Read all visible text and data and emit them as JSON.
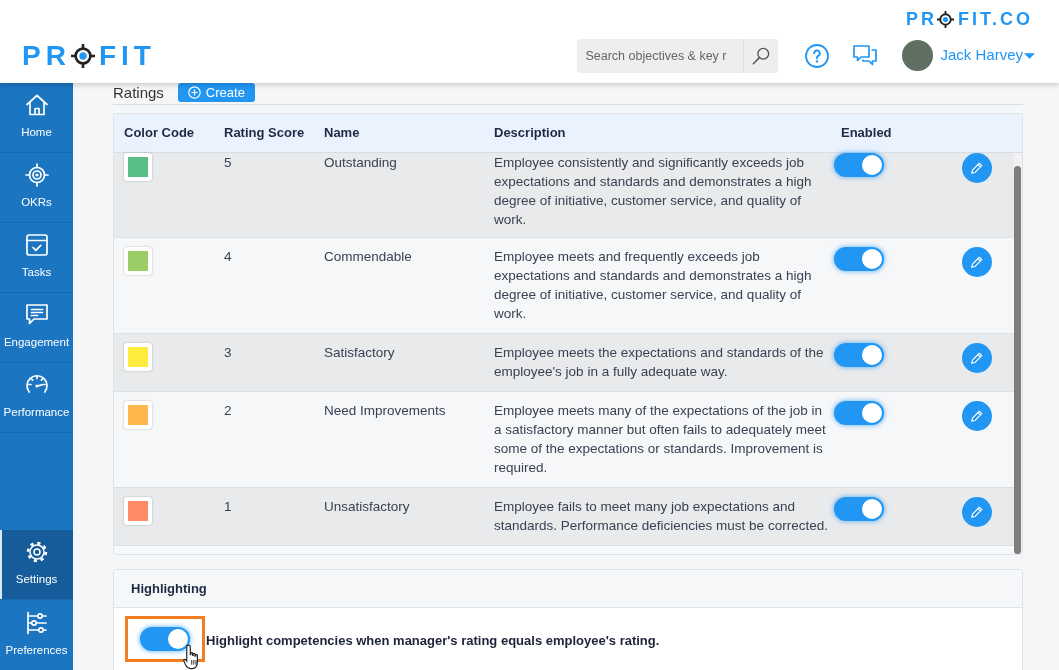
{
  "brand_mark": {
    "text_before": "PR",
    "text_after": "FIT.CO"
  },
  "header": {
    "logo": {
      "text_before": "PR",
      "text_after": "FIT"
    },
    "search": {
      "placeholder": "Search objectives & key r"
    },
    "user": {
      "name": "Jack Harvey"
    }
  },
  "sidebar": {
    "items": [
      {
        "label": "Home",
        "selected": false
      },
      {
        "label": "OKRs",
        "selected": false
      },
      {
        "label": "Tasks",
        "selected": false
      },
      {
        "label": "Engagement",
        "selected": false
      },
      {
        "label": "Performance",
        "selected": false
      }
    ],
    "bottom_items": [
      {
        "label": "Settings",
        "selected": true
      },
      {
        "label": "Preferences",
        "selected": false
      }
    ]
  },
  "page": {
    "title": "Ratings",
    "create_button": "Create"
  },
  "table": {
    "columns": [
      "Color Code",
      "Rating Score",
      "Name",
      "Description",
      "Enabled"
    ],
    "rows": [
      {
        "color": "#5abf87",
        "score": "5",
        "name": "Outstanding",
        "description": "Employee consistently and significantly exceeds job expectations and standards and demonstrates a high degree of initiative, customer service, and quality of work.",
        "enabled": true
      },
      {
        "color": "#9ccc65",
        "score": "4",
        "name": "Commendable",
        "description": "Employee meets and frequently exceeds job expectations and standards and demonstrates a high degree of initiative, customer service, and quality of work.",
        "enabled": true
      },
      {
        "color": "#ffeb3b",
        "score": "3",
        "name": "Satisfactory",
        "description": "Employee meets the expectations and standards of the employee's job in a fully adequate way.",
        "enabled": true
      },
      {
        "color": "#ffb74d",
        "score": "2",
        "name": "Need Improvements",
        "description": "Employee meets many of the expectations of the job in a satisfactory manner but often fails to adequately meet some of the expectations or standards. Improvement is required.",
        "enabled": true
      },
      {
        "color": "#ff8a65",
        "score": "1",
        "name": "Unsatisfactory",
        "description": "Employee fails to meet many job expectations and standards. Performance deficiencies must be corrected.",
        "enabled": true
      }
    ]
  },
  "highlighting": {
    "title": "Highlighting",
    "option": {
      "label": "Highlight competencies when manager's rating equals employee's rating.",
      "on": true
    }
  }
}
